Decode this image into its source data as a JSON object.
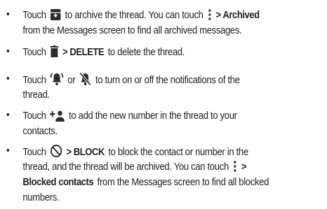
{
  "items": [
    {
      "lines": [
        [
          {
            "t": "Touch"
          },
          {
            "icon": "archive-icon"
          },
          {
            "t": "to archive the thread. You can touch"
          },
          {
            "icon": "overflow-menu-icon"
          },
          {
            "b": "> Archived"
          }
        ],
        [
          {
            "t": "from the Messages screen to find all archived messages."
          }
        ]
      ]
    },
    {
      "lines": [
        [
          {
            "t": "Touch"
          },
          {
            "icon": "trash-icon"
          },
          {
            "b": "> DELETE"
          },
          {
            "t": "to delete the thread."
          }
        ]
      ]
    },
    {
      "lines": [
        [
          {
            "t": "Touch"
          },
          {
            "icon": "notifications-on-icon"
          },
          {
            "t": "or"
          },
          {
            "icon": "notifications-off-icon"
          },
          {
            "t": "to turn on or off the notifications of the"
          }
        ],
        [
          {
            "t": "thread."
          }
        ]
      ]
    },
    {
      "lines": [
        [
          {
            "t": "Touch"
          },
          {
            "icon": "add-contact-icon"
          },
          {
            "t": "to add the new number in the thread to your"
          }
        ],
        [
          {
            "t": "contacts."
          }
        ]
      ]
    },
    {
      "lines": [
        [
          {
            "t": "Touch"
          },
          {
            "icon": "block-icon"
          },
          {
            "b": "> BLOCK"
          },
          {
            "t": "to block the contact or number in the"
          }
        ],
        [
          {
            "t": "thread, and the thread will be archived. You can touch"
          },
          {
            "icon": "overflow-menu-icon"
          },
          {
            "b": ">"
          }
        ],
        [
          {
            "b": "Blocked contacts"
          },
          {
            "t": "from the Messages screen to find all blocked"
          }
        ],
        [
          {
            "t": "numbers."
          }
        ]
      ]
    }
  ],
  "bullet_glyph": "•",
  "colors": {
    "text": "#222222",
    "icon": "#2b2b2b"
  }
}
